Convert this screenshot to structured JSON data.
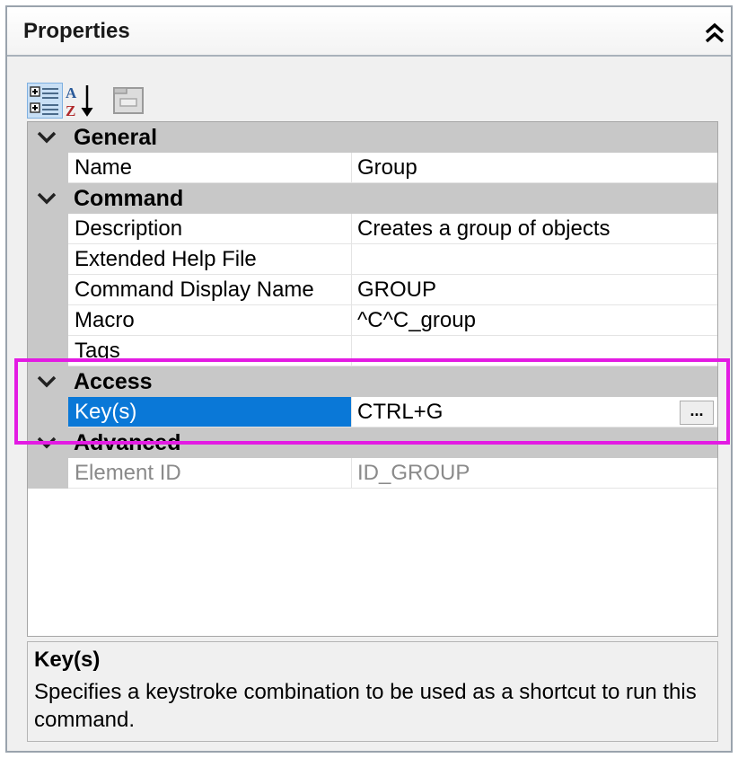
{
  "panel": {
    "title": "Properties",
    "collapse_icon": "double-chevron-up-icon"
  },
  "toolbar": {
    "buttons": [
      {
        "name": "categorized-view-icon",
        "active": true
      },
      {
        "name": "alphabetical-sort-icon",
        "active": false
      },
      {
        "name": "property-pages-icon",
        "active": false,
        "disabled": true
      }
    ]
  },
  "grid": {
    "categories": {
      "general": "General",
      "command": "Command",
      "access": "Access",
      "advanced": "Advanced"
    },
    "properties": {
      "name": {
        "label": "Name",
        "value": "Group"
      },
      "description": {
        "label": "Description",
        "value": "Creates a group of objects"
      },
      "extended_help": {
        "label": "Extended Help File",
        "value": ""
      },
      "display_name": {
        "label": "Command Display Name",
        "value": "GROUP"
      },
      "macro": {
        "label": "Macro",
        "value": "^C^C_group"
      },
      "tags": {
        "label": "Tags",
        "value": ""
      },
      "keys": {
        "label": "Key(s)",
        "value": "CTRL+G",
        "button": "..."
      },
      "element_id": {
        "label": "Element ID",
        "value": "ID_GROUP"
      }
    },
    "selected": "Key(s)"
  },
  "description_panel": {
    "title": "Key(s)",
    "text": "Specifies a keystroke combination to be used as a shortcut to run this command."
  },
  "colors": {
    "selection": "#0a78d7",
    "highlight_border": "#e31be3",
    "category_bg": "#c8c8c8"
  }
}
